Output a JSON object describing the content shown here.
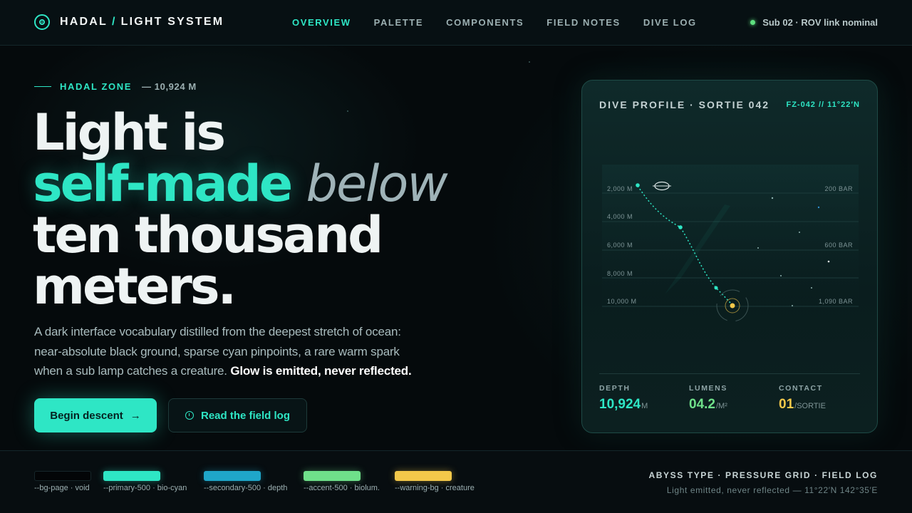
{
  "brand": {
    "name_left": "HADAL",
    "slash": "/",
    "name_right": "LIGHT SYSTEM"
  },
  "nav": {
    "items": [
      {
        "label": "OVERVIEW",
        "active": true
      },
      {
        "label": "PALETTE",
        "active": false
      },
      {
        "label": "COMPONENTS",
        "active": false
      },
      {
        "label": "FIELD NOTES",
        "active": false
      },
      {
        "label": "DIVE LOG",
        "active": false
      }
    ]
  },
  "status": {
    "text": "Sub 02 · ROV link nominal",
    "color": "#5ee07f"
  },
  "hero": {
    "eyebrow": "HADAL ZONE",
    "eyebrow_depth": "— 10,924 M",
    "line1": "Light is",
    "line2_accent": "self-made",
    "line2_italic": "below",
    "line3": "ten thousand",
    "line4": "meters.",
    "lede": "A dark interface vocabulary distilled from the deepest stretch of ocean: near-absolute black ground, sparse cyan pinpoints, a rare warm spark when a sub lamp catches a creature.",
    "lede_strong": "Glow is emitted, never reflected.",
    "primary_button": "Begin descent",
    "primary_arrow": "→",
    "secondary_button": "Read the field log"
  },
  "card": {
    "title": "DIVE PROFILE · SORTIE 042",
    "id": "FZ-042 // 11°22′N",
    "chart_data": {
      "type": "line",
      "depth_labels": [
        "2,000 M",
        "4,000 M",
        "6,000 M",
        "8,000 M",
        "10,000 M"
      ],
      "pressure_labels": [
        "200 BAR",
        "",
        "600 BAR",
        "",
        "1,090 BAR"
      ]
    },
    "stats": [
      {
        "label": "DEPTH",
        "value": "10,924",
        "unit": "M",
        "color": "#2ee6c5"
      },
      {
        "label": "LUMENS",
        "value": "04.2",
        "unit": "/M²",
        "color": "#6fe08a"
      },
      {
        "label": "CONTACT",
        "value": "01",
        "unit": "/SORTIE",
        "color": "#f3c84a"
      }
    ]
  },
  "footer": {
    "swatches": [
      {
        "label": "--bg-page · void",
        "color": "#030507"
      },
      {
        "label": "--primary-500 · bio-cyan",
        "color": "#2ee6c5"
      },
      {
        "label": "--secondary-500 · depth",
        "color": "#1fa6c9"
      },
      {
        "label": "--accent-500 · biolum.",
        "color": "#6fe08a"
      },
      {
        "label": "--warning-bg · creature",
        "color": "#f3c84a"
      }
    ],
    "title": "ABYSS TYPE · PRESSURE GRID · FIELD LOG",
    "subtitle": "Light emitted, never reflected — 11°22′N 142°35′E"
  }
}
